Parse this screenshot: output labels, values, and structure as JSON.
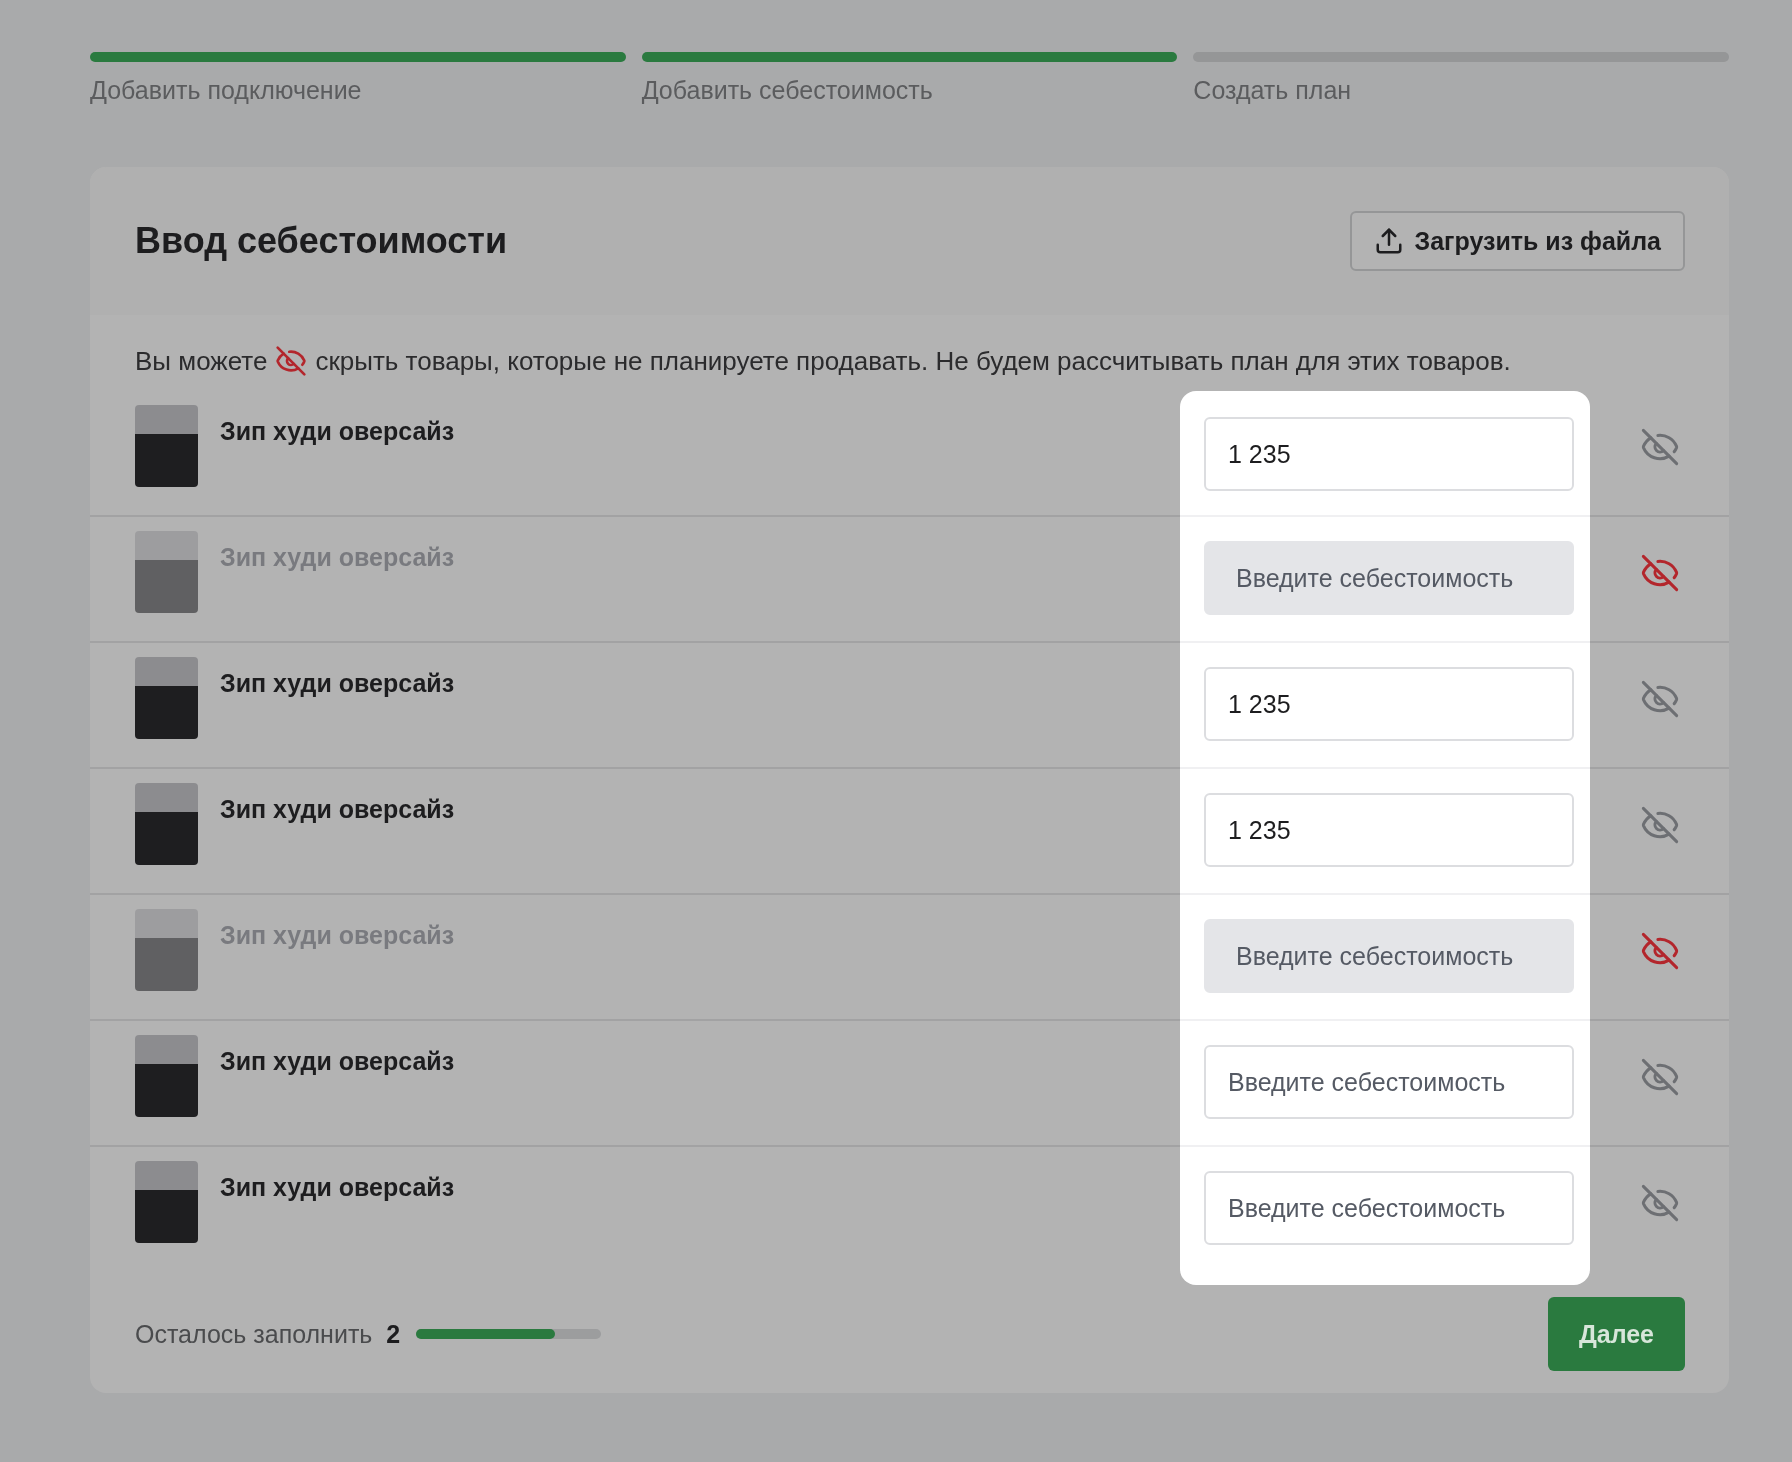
{
  "steps": [
    {
      "label": "Добавить подключение",
      "completed": true
    },
    {
      "label": "Добавить себестоимость",
      "completed": true
    },
    {
      "label": "Создать план",
      "completed": false
    }
  ],
  "card": {
    "title": "Ввод себестоимости",
    "upload_button": "Загрузить из файла",
    "hint_before": "Вы можете",
    "hint_after": "скрыть товары, которые не планируете продавать. Не будем рассчитывать план для этих товаров.",
    "products": [
      {
        "name": "Зип худи оверсайз",
        "hidden": false,
        "value": "1 235"
      },
      {
        "name": "Зип худи оверсайз",
        "hidden": true,
        "placeholder": "Введите себестоимость"
      },
      {
        "name": "Зип худи оверсайз",
        "hidden": false,
        "value": "1 235"
      },
      {
        "name": "Зип худи оверсайз",
        "hidden": false,
        "value": "1 235"
      },
      {
        "name": "Зип худи оверсайз",
        "hidden": true,
        "placeholder": "Введите себестоимость"
      },
      {
        "name": "Зип худи оверсайз",
        "hidden": false,
        "placeholder": "Введите себестоимость"
      },
      {
        "name": "Зип худи оверсайз",
        "hidden": false,
        "placeholder": "Введите себестоимость"
      }
    ],
    "remaining_label": "Осталось заполнить",
    "remaining_count": "2",
    "progress": {
      "level": 0.75
    },
    "next_button": "Далее"
  }
}
